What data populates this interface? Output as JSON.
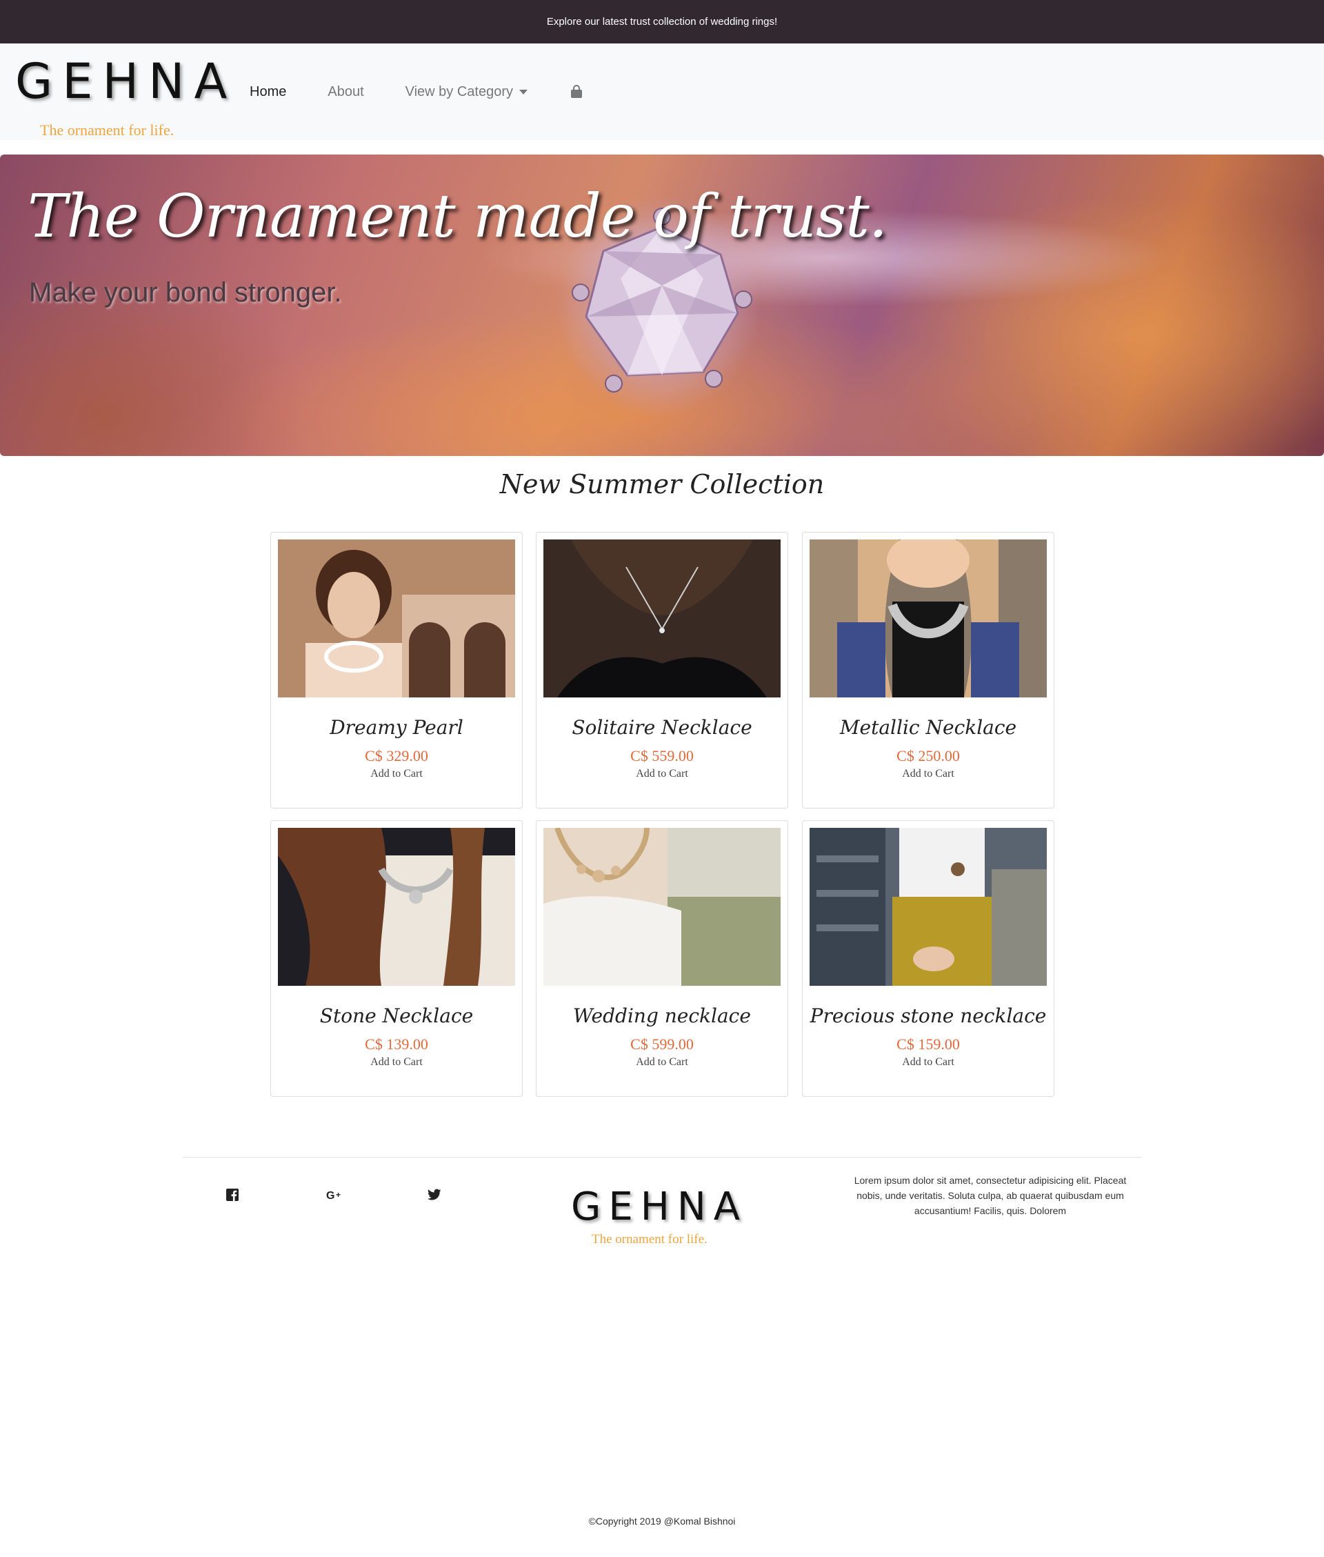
{
  "announcement": "Explore our latest trust collection of wedding rings!",
  "brand": {
    "name": "GEHNA",
    "tagline": "The ornament for life."
  },
  "nav": {
    "home": "Home",
    "about": "About",
    "category": "View by Category",
    "cart_icon": "shopping-bag-icon"
  },
  "hero": {
    "title": "The Ornament made of trust.",
    "subtitle": "Make your bond stronger."
  },
  "collection": {
    "title": "New Summer Collection",
    "cart_label": "Add to Cart",
    "products": [
      {
        "name": "Dreamy Pearl",
        "price": "C$ 329.00"
      },
      {
        "name": "Solitaire Necklace",
        "price": "C$ 559.00"
      },
      {
        "name": "Metallic Necklace",
        "price": "C$ 250.00"
      },
      {
        "name": "Stone Necklace",
        "price": "C$ 139.00"
      },
      {
        "name": "Wedding necklace",
        "price": "C$ 599.00"
      },
      {
        "name": "Precious stone necklace",
        "price": "C$ 159.00"
      }
    ]
  },
  "footer": {
    "social_icons": [
      "facebook-icon",
      "google-plus-icon",
      "twitter-icon"
    ],
    "about_text": "Lorem ipsum dolor sit amet, consectetur adipisicing elit. Placeat nobis, unde veritatis. Soluta culpa, ab quaerat quibusdam eum accusantium! Facilis, quis. Dolorem",
    "copyright": "©Copyright 2019 @Komal Bishnoi"
  },
  "colors": {
    "announcement_bg": "#322830",
    "navbar_bg": "#f8f9fa",
    "tagline": "#f0a440",
    "price": "#e06a3c"
  }
}
